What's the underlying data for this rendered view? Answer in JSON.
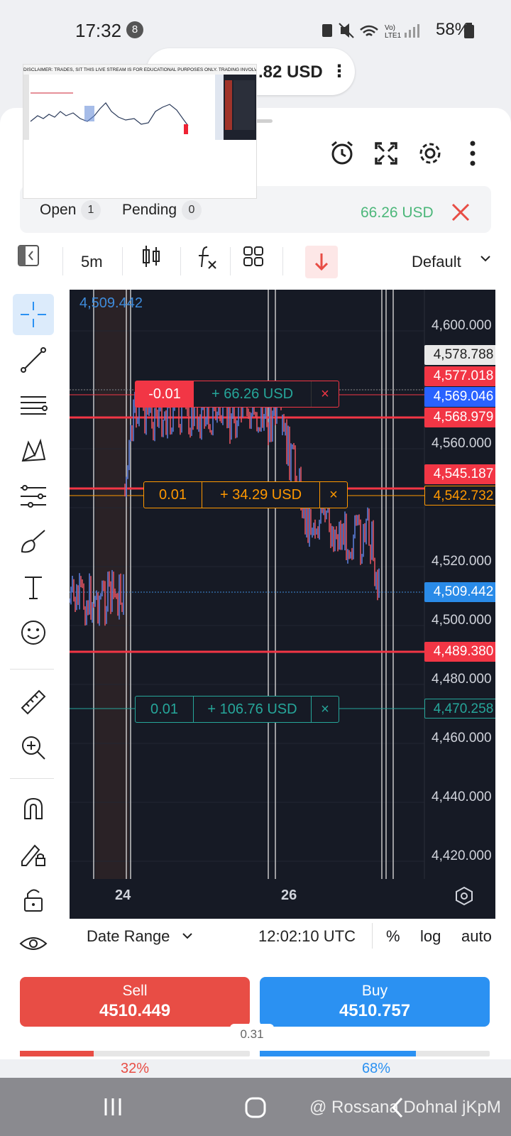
{
  "status_bar": {
    "time": "17:32",
    "notification_count": "8",
    "battery": "58%",
    "network": "LTE1"
  },
  "account": {
    "balance_partial": ".82 USD"
  },
  "stream_preview": {
    "banner": "DISCLAIMER: TRADES, SIT THIS LIVE STREAM IS FOR EDUCATIONAL PURPOSES ONLY. TRADING INVOLVES HIGH R"
  },
  "positions": {
    "open_label": "Open",
    "open_count": "1",
    "pending_label": "Pending",
    "pending_count": "0",
    "total_pnl": "66.26 USD"
  },
  "toolbar": {
    "timeframe": "5m",
    "layout": "Default"
  },
  "chart": {
    "crosshair_price": "4,509.442",
    "axis_prices": [
      "4,600.000",
      "4,560.000",
      "4,520.000",
      "4,500.000",
      "4,480.000",
      "4,460.000",
      "4,440.000",
      "4,420.000"
    ],
    "price_tags": [
      {
        "text": "4,578.788",
        "bg": "#e9e9e9",
        "fg": "#222222"
      },
      {
        "text": "4,577.018",
        "bg": "#f23645",
        "fg": "#ffffff"
      },
      {
        "text": "4,569.046",
        "bg": "#2962ff",
        "fg": "#ffffff"
      },
      {
        "text": "4,568.979",
        "bg": "#f23645",
        "fg": "#ffffff"
      },
      {
        "text": "4,545.187",
        "bg": "#f23645",
        "fg": "#ffffff"
      },
      {
        "text": "4,542.732",
        "bg": "#161a25",
        "fg": "#ff9800"
      },
      {
        "text": "4,509.442",
        "bg": "#2a8be8",
        "fg": "#ffffff"
      },
      {
        "text": "4,489.380",
        "bg": "#f23645",
        "fg": "#ffffff"
      },
      {
        "text": "4,470.258",
        "bg": "#161a25",
        "fg": "#26a69a"
      }
    ],
    "orders": [
      {
        "qty": "-0.01",
        "pnl": "+ 66.26 USD",
        "close": "×",
        "color": "#f23645"
      },
      {
        "qty": "0.01",
        "pnl": "+ 34.29 USD",
        "close": "×",
        "color": "#ff9800"
      },
      {
        "qty": "0.01",
        "pnl": "+ 106.76 USD",
        "close": "×",
        "color": "#26a69a"
      }
    ],
    "time_labels": [
      "24",
      "26"
    ]
  },
  "bottom_bar": {
    "date_range": "Date Range",
    "utc_time": "12:02:10 UTC",
    "percent": "%",
    "log": "log",
    "auto": "auto"
  },
  "trade": {
    "sell_label": "Sell",
    "sell_price": "4510.449",
    "buy_label": "Buy",
    "buy_price": "4510.757",
    "spread": "0.31",
    "sell_sentiment": "32%",
    "buy_sentiment": "68%",
    "sell_fraction": 0.32,
    "buy_fraction": 0.68
  },
  "watermark": "@ Rossana Dohnal jKpM",
  "colors": {
    "sell": "#e84d45",
    "buy": "#2b91f2",
    "profit": "#4cb77a",
    "chart_bg": "#161a25"
  }
}
